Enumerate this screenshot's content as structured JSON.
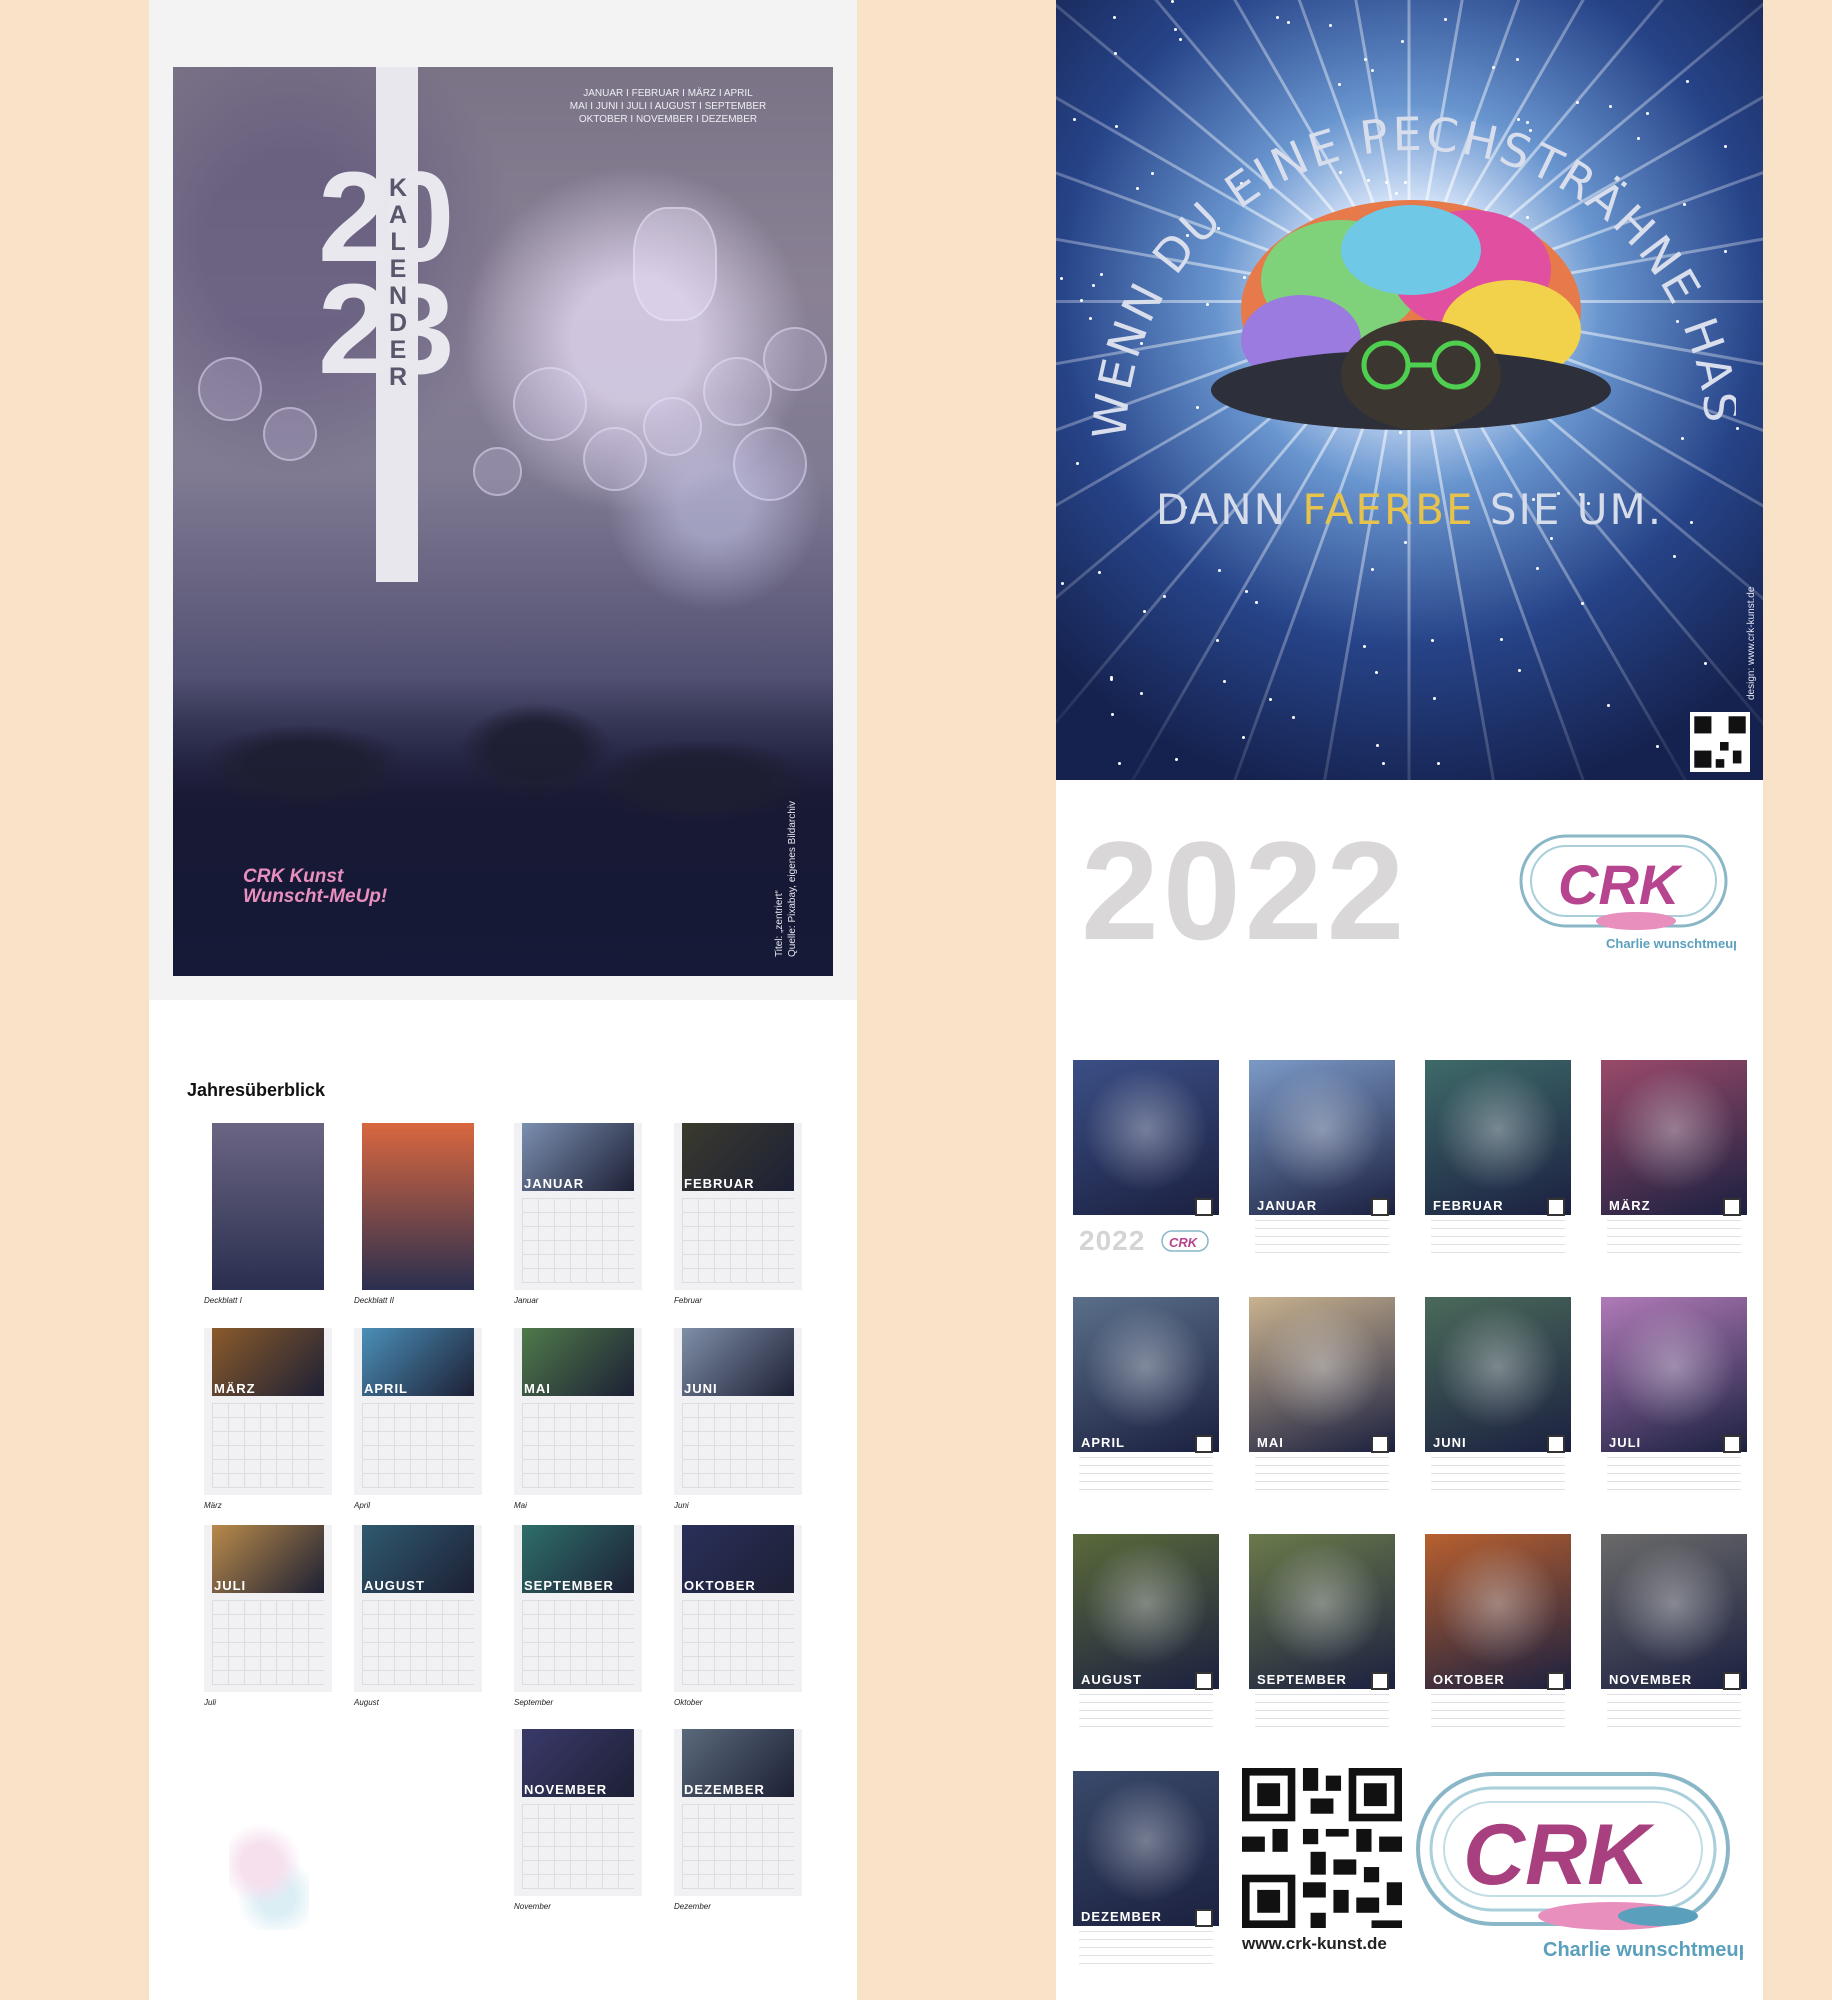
{
  "cover": {
    "months": [
      "JANUAR I FEBRUAR I MÄRZ I APRIL",
      "MAI I JUNI I JULI I AUGUST I SEPTEMBER",
      "OKTOBER I NOVEMBER I DEZEMBER"
    ],
    "year_top": "20",
    "year_bottom": "23",
    "label": "KALENDER",
    "credit_title": "Titel: „zentriert“",
    "credit_source": "Quelle: Pixabay, eigenes Bildarchiv",
    "logo_line1": "CRK Kunst",
    "logo_line2": "Wunscht-MeUp!"
  },
  "overview": {
    "title": "Jahresüberblick",
    "thumbnails": [
      {
        "caption": "Deckblatt I",
        "month": "",
        "color": "#6b6583"
      },
      {
        "caption": "Deckblatt II",
        "month": "",
        "color": "#d9673f"
      },
      {
        "caption": "Januar",
        "month": "JANUAR",
        "color": "#7b8fb0"
      },
      {
        "caption": "Februar",
        "month": "FEBRUAR",
        "color": "#3a3a2e"
      },
      {
        "caption": "März",
        "month": "MÄRZ",
        "color": "#8a5a2a"
      },
      {
        "caption": "April",
        "month": "APRIL",
        "color": "#4b8fb8"
      },
      {
        "caption": "Mai",
        "month": "MAI",
        "color": "#4f7a4a"
      },
      {
        "caption": "Juni",
        "month": "JUNI",
        "color": "#7f8fa8"
      },
      {
        "caption": "Juli",
        "month": "JULI",
        "color": "#b98a4a"
      },
      {
        "caption": "August",
        "month": "AUGUST",
        "color": "#2f5a6f"
      },
      {
        "caption": "September",
        "month": "SEPTEMBER",
        "color": "#2e6f6a"
      },
      {
        "caption": "Oktober",
        "month": "OKTOBER",
        "color": "#2a2f5a"
      },
      {
        "caption": "November",
        "month": "NOVEMBER",
        "color": "#3a3a6a"
      },
      {
        "caption": "Dezember",
        "month": "DEZEMBER",
        "color": "#5a6a7a"
      }
    ]
  },
  "poster": {
    "arc_text": "WENN DU EINE PECHSTRÄHNE HAST,",
    "line_pre": "DANN ",
    "line_color": "FAERBE",
    "line_post": " SIE UM.",
    "designer": "design: www.crk-kunst.de"
  },
  "calendar2022": {
    "year": "2022",
    "brand_name": "Charlie wunschtmeup",
    "brand_mark": "CRK",
    "cards": [
      {
        "month": "",
        "color": "#3b4f86"
      },
      {
        "month": "JANUAR",
        "color": "#7c9ac7"
      },
      {
        "month": "FEBRUAR",
        "color": "#3e6a69"
      },
      {
        "month": "MÄRZ",
        "color": "#9a4a6a"
      },
      {
        "month": "APRIL",
        "color": "#5a6f8a"
      },
      {
        "month": "MAI",
        "color": "#c9b28f"
      },
      {
        "month": "JUNI",
        "color": "#4a6a5a"
      },
      {
        "month": "JULI",
        "color": "#b07ab8"
      },
      {
        "month": "AUGUST",
        "color": "#5a6a3a"
      },
      {
        "month": "SEPTEMBER",
        "color": "#6a7a4a"
      },
      {
        "month": "OKTOBER",
        "color": "#b8602f"
      },
      {
        "month": "NOVEMBER",
        "color": "#6a6a6a"
      },
      {
        "month": "DEZEMBER",
        "color": "#3a4a6a"
      }
    ],
    "website": "www.crk-kunst.de"
  },
  "colors": {
    "background": "#f8e2c8",
    "year_gray": "#d9d7d7",
    "brand_blue": "#8ab7c8",
    "brand_pink": "#e88fbe"
  }
}
